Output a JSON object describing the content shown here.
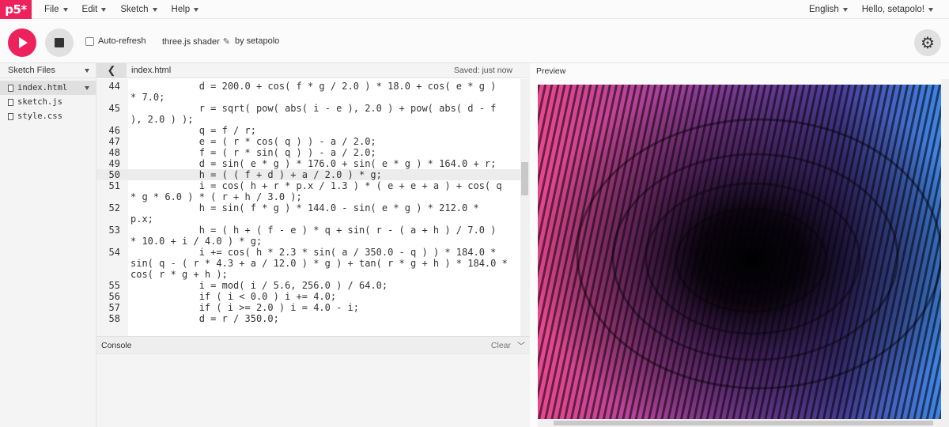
{
  "app": {
    "logo": "p5*"
  },
  "menu": {
    "items": [
      {
        "label": "File"
      },
      {
        "label": "Edit"
      },
      {
        "label": "Sketch"
      },
      {
        "label": "Help"
      }
    ],
    "language": "English",
    "user_greeting": "Hello, setapolo!"
  },
  "toolbar": {
    "auto_refresh_label": "Auto-refresh",
    "sketch_name": "three.js shader",
    "byline": "by setapolo"
  },
  "sidebar": {
    "title": "Sketch Files",
    "files": [
      {
        "name": "index.html",
        "active": true
      },
      {
        "name": "sketch.js",
        "active": false
      },
      {
        "name": "style.css",
        "active": false
      }
    ]
  },
  "editor": {
    "file_title": "index.html",
    "saved_status": "Saved: just now",
    "lines": [
      {
        "num": "44",
        "text": "            d = 200.0 + cos( f * g / 2.0 ) * 18.0 + cos( e * g )"
      },
      {
        "num": "",
        "text": "* 7.0;"
      },
      {
        "num": "45",
        "text": "            r = sqrt( pow( abs( i - e ), 2.0 ) + pow( abs( d - f"
      },
      {
        "num": "",
        "text": "), 2.0 ) );"
      },
      {
        "num": "46",
        "text": "            q = f / r;"
      },
      {
        "num": "47",
        "text": "            e = ( r * cos( q ) ) - a / 2.0;"
      },
      {
        "num": "48",
        "text": "            f = ( r * sin( q ) ) - a / 2.0;"
      },
      {
        "num": "49",
        "text": "            d = sin( e * g ) * 176.0 + sin( e * g ) * 164.0 + r;"
      },
      {
        "num": "50",
        "text": "            h = ( ( f + d ) + a / 2.0 ) * g;"
      },
      {
        "num": "51",
        "text": "            i = cos( h + r * p.x / 1.3 ) * ( e + e + a ) + cos( q"
      },
      {
        "num": "",
        "text": "* g * 6.0 ) * ( r + h / 3.0 );"
      },
      {
        "num": "52",
        "text": "            h = sin( f * g ) * 144.0 - sin( e * g ) * 212.0 *"
      },
      {
        "num": "",
        "text": "p.x;"
      },
      {
        "num": "53",
        "text": "            h = ( h + ( f - e ) * q + sin( r - ( a + h ) / 7.0 )"
      },
      {
        "num": "",
        "text": "* 10.0 + i / 4.0 ) * g;"
      },
      {
        "num": "54",
        "text": "            i += cos( h * 2.3 * sin( a / 350.0 - q ) ) * 184.0 *"
      },
      {
        "num": "",
        "text": "sin( q - ( r * 4.3 + a / 12.0 ) * g ) + tan( r * g + h ) * 184.0 *"
      },
      {
        "num": "",
        "text": "cos( r * g + h );"
      },
      {
        "num": "55",
        "text": "            i = mod( i / 5.6, 256.0 ) / 64.0;"
      },
      {
        "num": "56",
        "text": "            if ( i < 0.0 ) i += 4.0;"
      },
      {
        "num": "57",
        "text": "            if ( i >= 2.0 ) i = 4.0 - i;"
      },
      {
        "num": "58",
        "text": "            d = r / 350.0;"
      }
    ]
  },
  "console": {
    "title": "Console",
    "clear_label": "Clear"
  },
  "preview": {
    "label": "Preview"
  },
  "colors": {
    "accent": "#ed225d",
    "pink": "#e8488f",
    "blue": "#3f7fe0",
    "purple": "#6b3fa8"
  }
}
